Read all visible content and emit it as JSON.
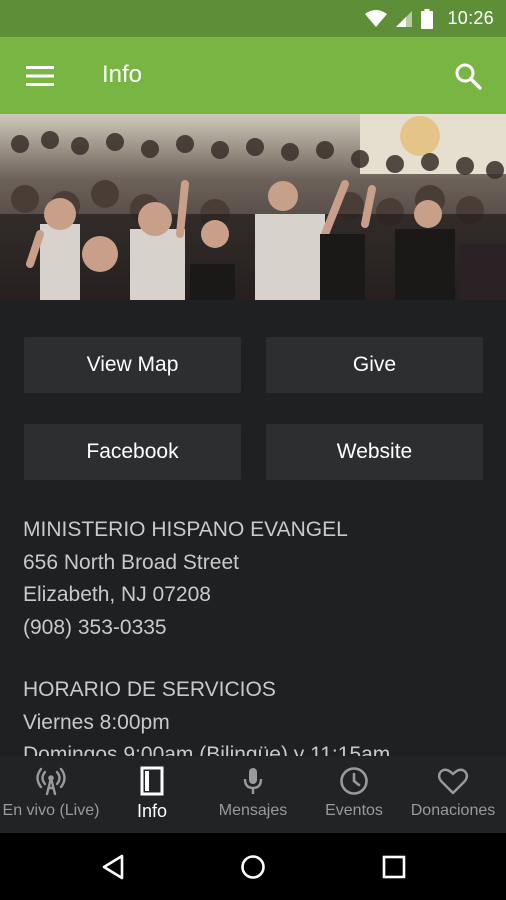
{
  "status_bar": {
    "time": "10:26"
  },
  "app_bar": {
    "title": "Info"
  },
  "buttons": {
    "view_map": "View Map",
    "give": "Give",
    "facebook": "Facebook",
    "website": "Website"
  },
  "info": {
    "org_name": "MINISTERIO HISPANO EVANGEL",
    "street": "656 North Broad Street",
    "city": "Elizabeth, NJ 07208",
    "phone": "(908) 353-0335",
    "schedule_heading": "HORARIO DE SERVICIOS",
    "schedule_line1": "Viernes 8:00pm",
    "schedule_line2": "Domingos 9:00am (Bilingüe) y 11:15am"
  },
  "bottom_nav": {
    "items": [
      {
        "label": "En vivo (Live)",
        "icon": "broadcast-icon"
      },
      {
        "label": "Info",
        "icon": "page-icon",
        "active": true
      },
      {
        "label": "Mensajes",
        "icon": "microphone-icon"
      },
      {
        "label": "Eventos",
        "icon": "clock-icon"
      },
      {
        "label": "Donaciones",
        "icon": "heart-icon"
      }
    ]
  },
  "colors": {
    "status_bar": "#5e8f38",
    "app_bar": "#78b543",
    "background": "#1f2021",
    "button": "#2d2e30",
    "nav_bar": "#222325"
  }
}
